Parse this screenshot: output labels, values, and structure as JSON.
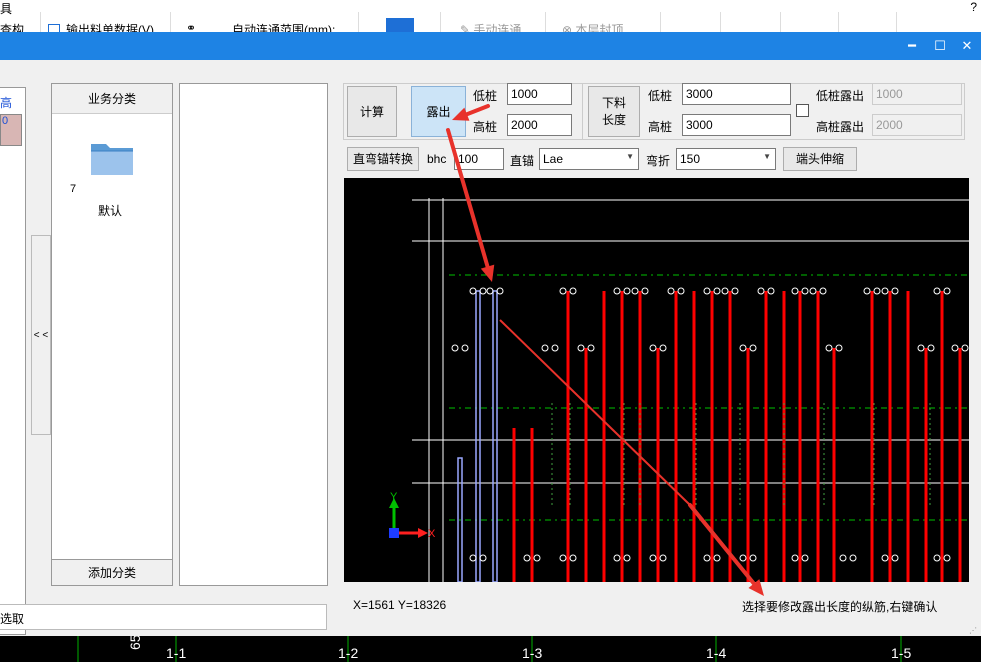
{
  "app": {
    "menu_title": "具",
    "help": "?",
    "toolbar": [
      {
        "label": "查构",
        "dim": false
      },
      {
        "label": "输出料单数据(V)",
        "dim": false
      },
      {
        "label": "自动连通范围(mm):",
        "dim": false
      },
      {
        "label": "手动连通",
        "dim": true
      },
      {
        "label": "本层封顶",
        "dim": true
      }
    ]
  },
  "window": {
    "minimize": "━",
    "maximize": "☐",
    "close": "✕"
  },
  "left": {
    "strip_label": "高",
    "strip_cell": "0",
    "collapse": "< <",
    "category_header": "业务分类",
    "category_count": "7",
    "category_name": "默认",
    "add_category": "添加分类",
    "status": "选取"
  },
  "tools": {
    "calc": "计算",
    "expose": "露出",
    "low_pile_label": "低桩",
    "low_pile_value": "1000",
    "high_pile_label": "高桩",
    "high_pile_value": "2000",
    "lower_len": "下料长度",
    "lower_low_label": "低桩",
    "lower_low_value": "3000",
    "lower_high_label": "高桩",
    "lower_high_value": "3000",
    "low_expose_label": "低桩露出",
    "low_expose_value": "1000",
    "high_expose_label": "高桩露出",
    "high_expose_value": "2000",
    "anchor_convert": "直弯锚转换",
    "bhc_label": "bhc",
    "bhc_value": "100",
    "straight_label": "直锚",
    "straight_value": "Lae",
    "bend_label": "弯折",
    "bend_value": "150",
    "end_stretch": "端头伸缩"
  },
  "canvas": {
    "coord": "X=1561 Y=18326",
    "hint": "选择要修改露出长度的纵筋,右键确认",
    "axis_labels": [
      "1-1",
      "1-2",
      "1-3",
      "1-4",
      "1-5"
    ],
    "colors": {
      "rebar": "#ff0000",
      "selected": "#9aa8ff",
      "grid": "#ffffff",
      "dashed": "#00c000",
      "arrow": "#e8322b"
    }
  }
}
